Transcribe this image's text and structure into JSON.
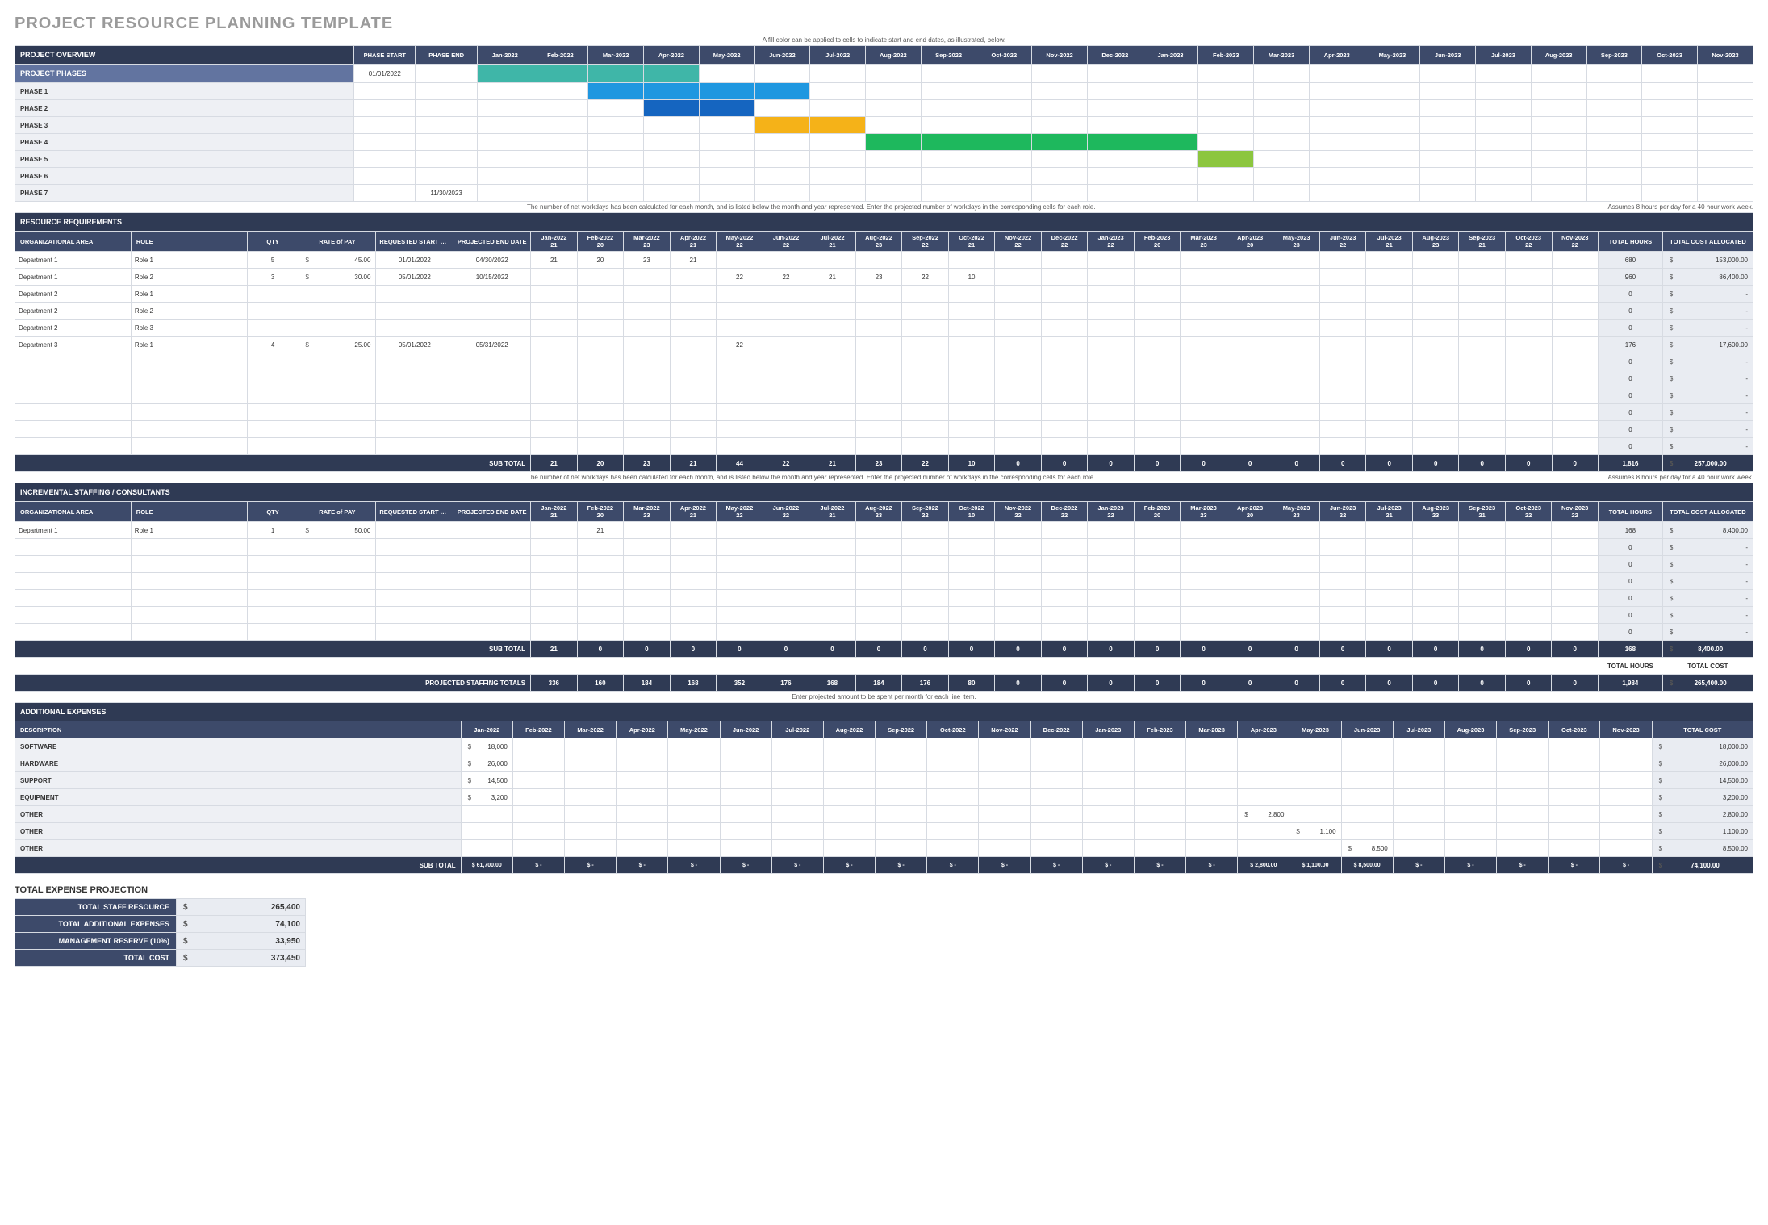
{
  "title": "PROJECT RESOURCE PLANNING TEMPLATE",
  "notes": {
    "gantt": "A fill color can be applied to cells to indicate start and end dates, as illustrated, below.",
    "resource_left": "The number of net workdays has been calculated for each month, and is listed below the month and year represented. Enter the projected number of workdays in the corresponding cells for each role.",
    "resource_right": "Assumes 8 hours per day for a 40 hour work week.",
    "expenses": "Enter projected amount to be spent per month for each line item."
  },
  "months": [
    "Jan-2022",
    "Feb-2022",
    "Mar-2022",
    "Apr-2022",
    "May-2022",
    "Jun-2022",
    "Jul-2022",
    "Aug-2022",
    "Sep-2022",
    "Oct-2022",
    "Nov-2022",
    "Dec-2022",
    "Jan-2023",
    "Feb-2023",
    "Mar-2023",
    "Apr-2023",
    "May-2023",
    "Jun-2023",
    "Jul-2023",
    "Aug-2023",
    "Sep-2023",
    "Oct-2023",
    "Nov-2023"
  ],
  "workdays": [
    "21",
    "20",
    "23",
    "21",
    "22",
    "22",
    "21",
    "23",
    "22",
    "21",
    "22",
    "22",
    "22",
    "20",
    "23",
    "20",
    "23",
    "22",
    "21",
    "23",
    "21",
    "22",
    "22"
  ],
  "workdays2": [
    "21",
    "20",
    "23",
    "21",
    "22",
    "22",
    "21",
    "23",
    "22",
    "10",
    "22",
    "22",
    "22",
    "20",
    "23",
    "20",
    "23",
    "22",
    "21",
    "23",
    "21",
    "22",
    "22"
  ],
  "overview": {
    "header": "PROJECT OVERVIEW",
    "cols": [
      "PHASE START",
      "PHASE END"
    ],
    "phases_label": "PROJECT PHASES",
    "phases_start": "01/01/2022",
    "rows": [
      {
        "name": "PHASE 1",
        "bar": {
          "start": 2,
          "len": 4,
          "cls": "c-blue"
        }
      },
      {
        "name": "PHASE 2",
        "bar": {
          "start": 3,
          "len": 2,
          "cls": "c-dblue"
        }
      },
      {
        "name": "PHASE 3",
        "bar": {
          "start": 5,
          "len": 2,
          "cls": "c-orange"
        }
      },
      {
        "name": "PHASE 4",
        "bar": {
          "start": 7,
          "len": 6,
          "cls": "c-green"
        }
      },
      {
        "name": "PHASE 5",
        "bar": {
          "start": 13,
          "len": 1,
          "cls": "c-lime"
        }
      },
      {
        "name": "PHASE 6"
      },
      {
        "name": "PHASE 7",
        "end": "11/30/2023"
      }
    ],
    "top_bar": {
      "start": 0,
      "len": 4,
      "cls": "c-teal"
    }
  },
  "resources": {
    "header": "RESOURCE REQUIREMENTS",
    "cols": [
      "ORGANIZATIONAL AREA",
      "ROLE",
      "QTY",
      "RATE of PAY",
      "REQUESTED START DATE",
      "PROJECTED END DATE"
    ],
    "tot_cols": [
      "TOTAL HOURS",
      "TOTAL COST ALLOCATED"
    ],
    "rows": [
      {
        "area": "Department 1",
        "role": "Role 1",
        "qty": "5",
        "rate": "45.00",
        "start": "01/01/2022",
        "end": "04/30/2022",
        "vals": [
          "21",
          "20",
          "23",
          "21",
          "",
          "",
          "",
          "",
          "",
          "",
          "",
          "",
          "",
          "",
          "",
          "",
          "",
          "",
          "",
          "",
          "",
          "",
          ""
        ],
        "hours": "680",
        "cost": "153,000.00"
      },
      {
        "area": "Department 1",
        "role": "Role 2",
        "qty": "3",
        "rate": "30.00",
        "start": "05/01/2022",
        "end": "10/15/2022",
        "vals": [
          "",
          "",
          "",
          "",
          "22",
          "22",
          "21",
          "23",
          "22",
          "10",
          "",
          "",
          "",
          "",
          "",
          "",
          "",
          "",
          "",
          "",
          "",
          "",
          ""
        ],
        "hours": "960",
        "cost": "86,400.00"
      },
      {
        "area": "Department 2",
        "role": "Role 1",
        "vals": [],
        "hours": "0",
        "cost": "-"
      },
      {
        "area": "Department 2",
        "role": "Role 2",
        "vals": [],
        "hours": "0",
        "cost": "-"
      },
      {
        "area": "Department 2",
        "role": "Role 3",
        "vals": [],
        "hours": "0",
        "cost": "-"
      },
      {
        "area": "Department 3",
        "role": "Role 1",
        "qty": "4",
        "rate": "25.00",
        "start": "05/01/2022",
        "end": "05/31/2022",
        "vals": [
          "",
          "",
          "",
          "",
          "22",
          "",
          "",
          "",
          "",
          "",
          "",
          "",
          "",
          "",
          "",
          "",
          "",
          "",
          "",
          "",
          "",
          "",
          ""
        ],
        "hours": "176",
        "cost": "17,600.00"
      },
      {
        "vals": [],
        "hours": "0",
        "cost": "-"
      },
      {
        "vals": [],
        "hours": "0",
        "cost": "-"
      },
      {
        "vals": [],
        "hours": "0",
        "cost": "-"
      },
      {
        "vals": [],
        "hours": "0",
        "cost": "-"
      },
      {
        "vals": [],
        "hours": "0",
        "cost": "-"
      },
      {
        "vals": [],
        "hours": "0",
        "cost": "-"
      }
    ],
    "subtotal_label": "SUB TOTAL",
    "subtotal": [
      "21",
      "20",
      "23",
      "21",
      "44",
      "22",
      "21",
      "23",
      "22",
      "10",
      "0",
      "0",
      "0",
      "0",
      "0",
      "0",
      "0",
      "0",
      "0",
      "0",
      "0",
      "0",
      "0"
    ],
    "subtotal_hours": "1,816",
    "subtotal_cost": "257,000.00"
  },
  "consultants": {
    "header": "INCREMENTAL STAFFING / CONSULTANTS",
    "rows": [
      {
        "area": "Department 1",
        "role": "Role 1",
        "qty": "1",
        "rate": "50.00",
        "vals": [
          "",
          "21",
          "",
          "",
          "",
          "",
          "",
          "",
          "",
          "",
          "",
          "",
          "",
          "",
          "",
          "",
          "",
          "",
          "",
          "",
          "",
          "",
          ""
        ],
        "hours": "168",
        "cost": "8,400.00"
      },
      {
        "vals": [],
        "hours": "0",
        "cost": "-"
      },
      {
        "vals": [],
        "hours": "0",
        "cost": "-"
      },
      {
        "vals": [],
        "hours": "0",
        "cost": "-"
      },
      {
        "vals": [],
        "hours": "0",
        "cost": "-"
      },
      {
        "vals": [],
        "hours": "0",
        "cost": "-"
      },
      {
        "vals": [],
        "hours": "0",
        "cost": "-"
      }
    ],
    "subtotal_label": "SUB TOTAL",
    "subtotal": [
      "21",
      "0",
      "0",
      "0",
      "0",
      "0",
      "0",
      "0",
      "0",
      "0",
      "0",
      "0",
      "0",
      "0",
      "0",
      "0",
      "0",
      "0",
      "0",
      "0",
      "0",
      "0",
      "0"
    ],
    "subtotal_hours": "168",
    "subtotal_cost": "8,400.00",
    "grand_label": "PROJECTED STAFFING TOTALS",
    "grand_hours_label": "TOTAL HOURS",
    "grand_cost_label": "TOTAL COST",
    "grand": [
      "336",
      "160",
      "184",
      "168",
      "352",
      "176",
      "168",
      "184",
      "176",
      "80",
      "0",
      "0",
      "0",
      "0",
      "0",
      "0",
      "0",
      "0",
      "0",
      "0",
      "0",
      "0",
      "0"
    ],
    "grand_hours": "1,984",
    "grand_cost": "265,400.00"
  },
  "expenses": {
    "header": "ADDITIONAL EXPENSES",
    "desc": "DESCRIPTION",
    "total": "TOTAL COST",
    "rows": [
      {
        "name": "SOFTWARE",
        "vals": [
          "18,000",
          "",
          "",
          "",
          "",
          "",
          "",
          "",
          "",
          "",
          "",
          "",
          "",
          "",
          "",
          "",
          "",
          "",
          "",
          "",
          "",
          "",
          ""
        ],
        "cost": "18,000.00"
      },
      {
        "name": "HARDWARE",
        "vals": [
          "26,000",
          "",
          "",
          "",
          "",
          "",
          "",
          "",
          "",
          "",
          "",
          "",
          "",
          "",
          "",
          "",
          "",
          "",
          "",
          "",
          "",
          "",
          ""
        ],
        "cost": "26,000.00"
      },
      {
        "name": "SUPPORT",
        "vals": [
          "14,500",
          "",
          "",
          "",
          "",
          "",
          "",
          "",
          "",
          "",
          "",
          "",
          "",
          "",
          "",
          "",
          "",
          "",
          "",
          "",
          "",
          "",
          ""
        ],
        "cost": "14,500.00"
      },
      {
        "name": "EQUIPMENT",
        "vals": [
          "3,200",
          "",
          "",
          "",
          "",
          "",
          "",
          "",
          "",
          "",
          "",
          "",
          "",
          "",
          "",
          "",
          "",
          "",
          "",
          "",
          "",
          "",
          ""
        ],
        "cost": "3,200.00"
      },
      {
        "name": "OTHER",
        "vals": [
          "",
          "",
          "",
          "",
          "",
          "",
          "",
          "",
          "",
          "",
          "",
          "",
          "",
          "",
          "",
          "2,800",
          "",
          "",
          "",
          "",
          "",
          "",
          ""
        ],
        "cost": "2,800.00"
      },
      {
        "name": "OTHER",
        "vals": [
          "",
          "",
          "",
          "",
          "",
          "",
          "",
          "",
          "",
          "",
          "",
          "",
          "",
          "",
          "",
          "",
          "1,100",
          "",
          "",
          "",
          "",
          "",
          ""
        ],
        "cost": "1,100.00"
      },
      {
        "name": "OTHER",
        "vals": [
          "",
          "",
          "",
          "",
          "",
          "",
          "",
          "",
          "",
          "",
          "",
          "",
          "",
          "",
          "",
          "",
          "",
          "8,500",
          "",
          "",
          "",
          "",
          ""
        ],
        "cost": "8,500.00"
      }
    ],
    "subtotal_label": "SUB TOTAL",
    "subtotal": [
      "$ 61,700.00",
      "$     -",
      "$     -",
      "$     -",
      "$     -",
      "$     -",
      "$     -",
      "$     -",
      "$     -",
      "$     -",
      "$     -",
      "$     -",
      "$     -",
      "$     -",
      "$     -",
      "$ 2,800.00",
      "$ 1,100.00",
      "$ 8,500.00",
      "$     -",
      "$     -",
      "$     -",
      "$     -",
      "$     -"
    ],
    "subtotal_cost": "74,100.00"
  },
  "summary": {
    "header": "TOTAL EXPENSE PROJECTION",
    "rows": [
      {
        "label": "TOTAL STAFF RESOURCE",
        "val": "265,400"
      },
      {
        "label": "TOTAL ADDITIONAL EXPENSES",
        "val": "74,100"
      },
      {
        "label": "MANAGEMENT RESERVE (10%)",
        "val": "33,950"
      },
      {
        "label": "TOTAL COST",
        "val": "373,450"
      }
    ]
  }
}
